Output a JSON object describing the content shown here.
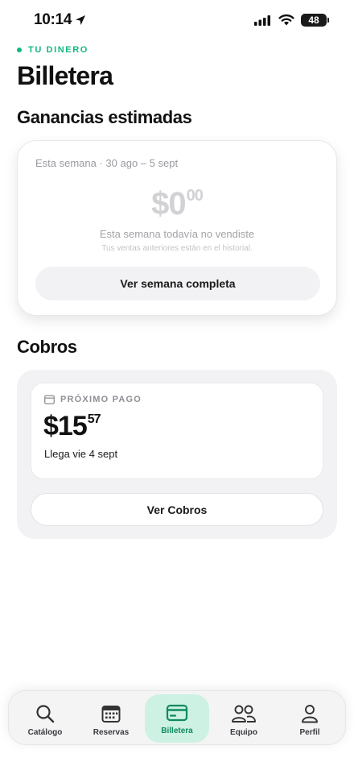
{
  "status_bar": {
    "time": "10:14",
    "battery": "48"
  },
  "header": {
    "eyebrow": "TU DINERO",
    "title": "Billetera"
  },
  "earnings": {
    "section_title": "Ganancias estimadas",
    "period": "Esta semana · 30 ago – 5 sept",
    "amount_whole": "$0",
    "amount_cents": "00",
    "message": "Esta semana todavía no vendiste",
    "hint": "Tus ventas anteriores están en el historial.",
    "button_label": "Ver semana completa"
  },
  "payouts": {
    "section_title": "Cobros",
    "next_label": "PRÓXIMO PAGO",
    "amount_whole": "$15",
    "amount_cents": "57",
    "arrival": "Llega vie 4 sept",
    "button_label": "Ver Cobros"
  },
  "tab_bar": {
    "tabs": [
      {
        "label": "Catálogo",
        "icon": "search-icon"
      },
      {
        "label": "Reservas",
        "icon": "calendar-icon"
      },
      {
        "label": "Billetera",
        "icon": "card-icon",
        "active": true
      },
      {
        "label": "Equipo",
        "icon": "people-icon"
      },
      {
        "label": "Perfil",
        "icon": "person-icon"
      }
    ]
  },
  "colors": {
    "accent": "#10b981",
    "accent_dark": "#0f8a5f",
    "active_tab_bg": "#cdf1e2"
  }
}
